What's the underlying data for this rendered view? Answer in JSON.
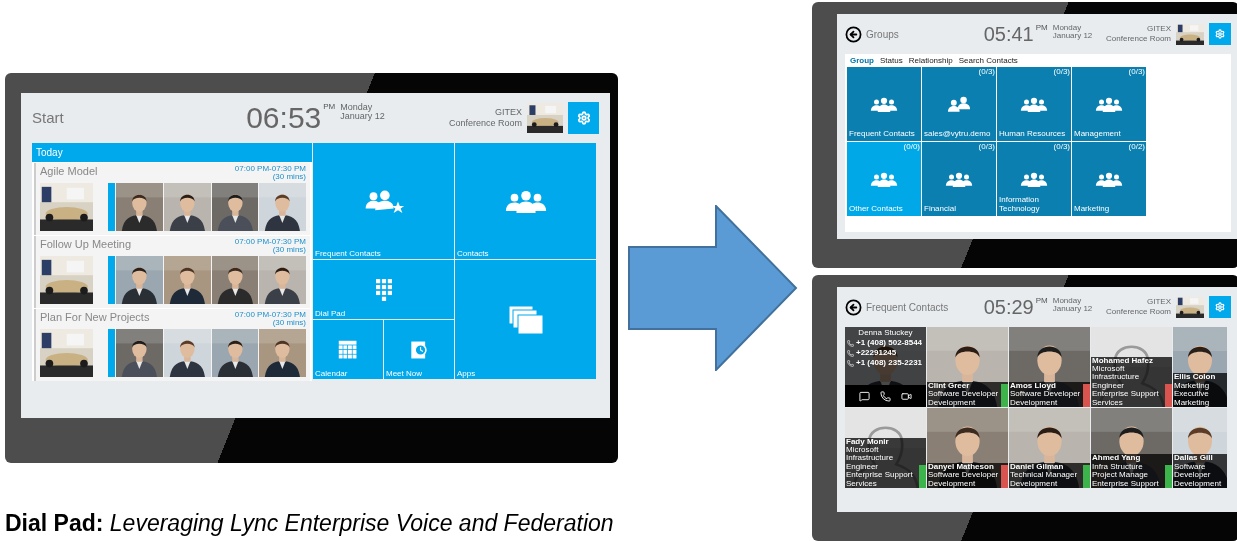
{
  "start_screen": {
    "title": "Start",
    "time": "06:53",
    "meridiem": "PM",
    "day": "Monday",
    "date": "January 12",
    "room_name": "GITEX",
    "room_type": "Conference Room",
    "agenda": {
      "header": "Today",
      "meetings": [
        {
          "title": "Agile Model",
          "time": "07:00 PM-07:30 PM",
          "duration": "(30 mins)"
        },
        {
          "title": "Follow Up Meeting",
          "time": "07:00 PM-07:30 PM",
          "duration": "(30 mins)"
        },
        {
          "title": "Plan For New Projects",
          "time": "07:00 PM-07:30 PM",
          "duration": "(30 mins)"
        }
      ]
    },
    "tiles": [
      {
        "label": "Frequent Contacts",
        "kind": "frequent-contacts"
      },
      {
        "label": "Contacts",
        "kind": "contacts"
      },
      {
        "label": "Dial Pad",
        "kind": "dial-pad"
      },
      {
        "label": "Calendar",
        "kind": "calendar"
      },
      {
        "label": "Meet Now",
        "kind": "meet-now"
      },
      {
        "label": "Apps",
        "kind": "apps"
      }
    ]
  },
  "groups_screen": {
    "title": "Groups",
    "time": "05:41",
    "meridiem": "PM",
    "day": "Monday",
    "date": "January 12",
    "room_name": "GITEX",
    "room_type": "Conference Room",
    "tabs": [
      {
        "label": "Group",
        "selected": true
      },
      {
        "label": "Status",
        "selected": false
      },
      {
        "label": "Relationship",
        "selected": false
      },
      {
        "label": "Search Contacts",
        "selected": false
      }
    ],
    "groups": [
      {
        "label": "Frequent Contacts",
        "kind": "group",
        "selected": false
      },
      {
        "label": "sales@vytru.demo",
        "count": "(0/3)",
        "kind": "pair",
        "selected": false
      },
      {
        "label": "Human Resources",
        "count": "(0/3)",
        "kind": "group",
        "selected": false
      },
      {
        "label": "Management",
        "count": "(0/3)",
        "kind": "group",
        "selected": false
      },
      {
        "label": "Other Contacts",
        "count": "(0/0)",
        "kind": "group",
        "selected": true
      },
      {
        "label": "Financial",
        "count": "(0/3)",
        "kind": "group",
        "selected": false
      },
      {
        "label": "Information Technology",
        "count": "(0/3)",
        "kind": "group",
        "selected": false
      },
      {
        "label": "Marketing",
        "count": "(0/2)",
        "kind": "group",
        "selected": false
      }
    ]
  },
  "contacts_screen": {
    "title": "Frequent Contacts",
    "time": "05:29",
    "meridiem": "PM",
    "day": "Monday",
    "date": "January 12",
    "room_name": "GITEX",
    "room_type": "Conference Room",
    "expanded_contact": {
      "name": "Denna Stuckey",
      "phones": [
        "+1 (408) 502-8544",
        "+22291245",
        "+1 (408) 235-2231"
      ]
    },
    "contacts": [
      {
        "name": "Clint Greer",
        "title": "Software Developer",
        "department": "Development",
        "color": "#3cb44b"
      },
      {
        "name": "Amos Lloyd",
        "title": "Software Developer",
        "department": "Development",
        "color": "#d9534f"
      },
      {
        "name": "Mohamed Hafez",
        "title": "Microsoft Infrastructure Engineer",
        "department": "Enterprise Support Services",
        "kind": "placeholder",
        "color": "#d9534f"
      },
      {
        "name": "Ellis Colon",
        "title": "Marketing Executive",
        "department": "Marketing"
      },
      {
        "name": "Fady Monir",
        "title": "Microsoft Infrastructure Engineer",
        "department": "Enterprise Support Services",
        "kind": "placeholder",
        "color": "#3cb44b"
      },
      {
        "name": "Danyel Matheson",
        "title": "Software Developer",
        "department": "Development",
        "color": "#d9534f"
      },
      {
        "name": "Daniel Gilman",
        "title": "Technical Manager",
        "department": "Development",
        "color": "#3cb44b"
      },
      {
        "name": "Ahmed Yang",
        "title": "Infra Structure Project Manage",
        "department": "Enterprise Support",
        "color": "#3cb44b"
      },
      {
        "name": "Dallas Gill",
        "title": "Software Developer",
        "department": "Development"
      }
    ]
  },
  "caption": "**Dial Pad:** *Leveraging Lync Enterprise Voice and Federation*"
}
